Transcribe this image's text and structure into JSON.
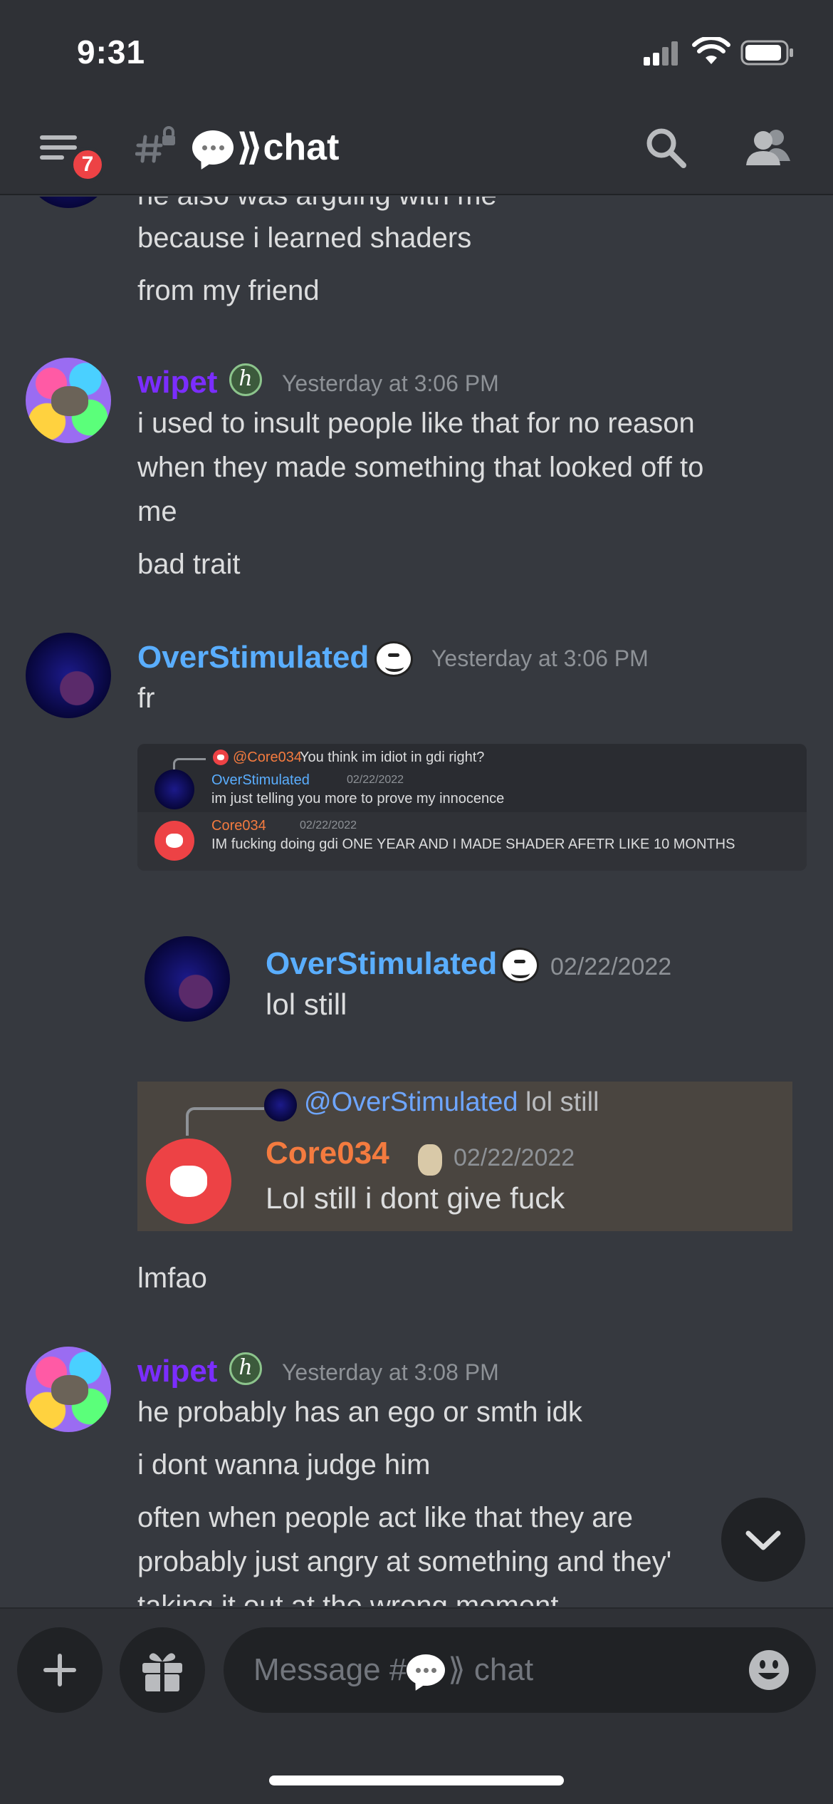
{
  "status_bar": {
    "time": "9:31"
  },
  "header": {
    "badge_count": "7",
    "channel_name": "⟫chat"
  },
  "messages": {
    "partial_top_line": "he also was arguing with me",
    "continuation": [
      "because i learned shaders",
      "from my friend"
    ],
    "wipet_1": {
      "username": "wipet",
      "timestamp": "Yesterday at 3:06 PM",
      "lines": [
        "i used to insult people like that for no reason",
        "when they made something that looked off to",
        "me",
        "bad trait"
      ]
    },
    "over_1": {
      "username": "OverStimulated",
      "timestamp": "Yesterday at 3:06 PM",
      "lines": [
        "fr"
      ],
      "image_1": {
        "reply_mention": "@Core034",
        "reply_text": "You think im idiot in gdi right?",
        "user_a": "OverStimulated",
        "date_a": "02/22/2022",
        "text_a": "im just telling you more to prove my innocence",
        "user_b": "Core034",
        "date_b": "02/22/2022",
        "text_b": "IM fucking doing gdi ONE YEAR AND I MADE SHADER AFETR LIKE 10 MONTHS"
      },
      "image_2": {
        "user": "OverStimulated",
        "date": "02/22/2022",
        "text": "lol still"
      },
      "image_3": {
        "reply_mention": "@OverStimulated",
        "reply_text": "lol still",
        "user": "Core034",
        "date": "02/22/2022",
        "text": "Lol still i dont give fuck"
      },
      "after_text": "lmfao"
    },
    "wipet_2": {
      "username": "wipet",
      "timestamp": "Yesterday at 3:08 PM",
      "lines": [
        "he probably has an ego or smth idk",
        "i dont wanna judge him",
        "often when people act like that they are",
        "probably just angry at something and they'",
        "taking it out at the wrong moment"
      ]
    }
  },
  "composer": {
    "placeholder_prefix": "Message #",
    "placeholder_suffix": "⟫ chat"
  },
  "icons": {
    "menu": "menu-icon",
    "hash_lock": "locked-hash-icon",
    "search": "search-icon",
    "members": "members-icon",
    "plus": "plus-icon",
    "gift": "gift-icon",
    "emoji": "emoji-icon",
    "jump": "chevron-down-icon"
  },
  "colors": {
    "background": "#36393f",
    "header": "#2f3136",
    "wipet_name": "#7b2dff",
    "overstimulated_name": "#5aaeff",
    "core034_name": "#f47b3f",
    "badge": "#ed4245"
  }
}
